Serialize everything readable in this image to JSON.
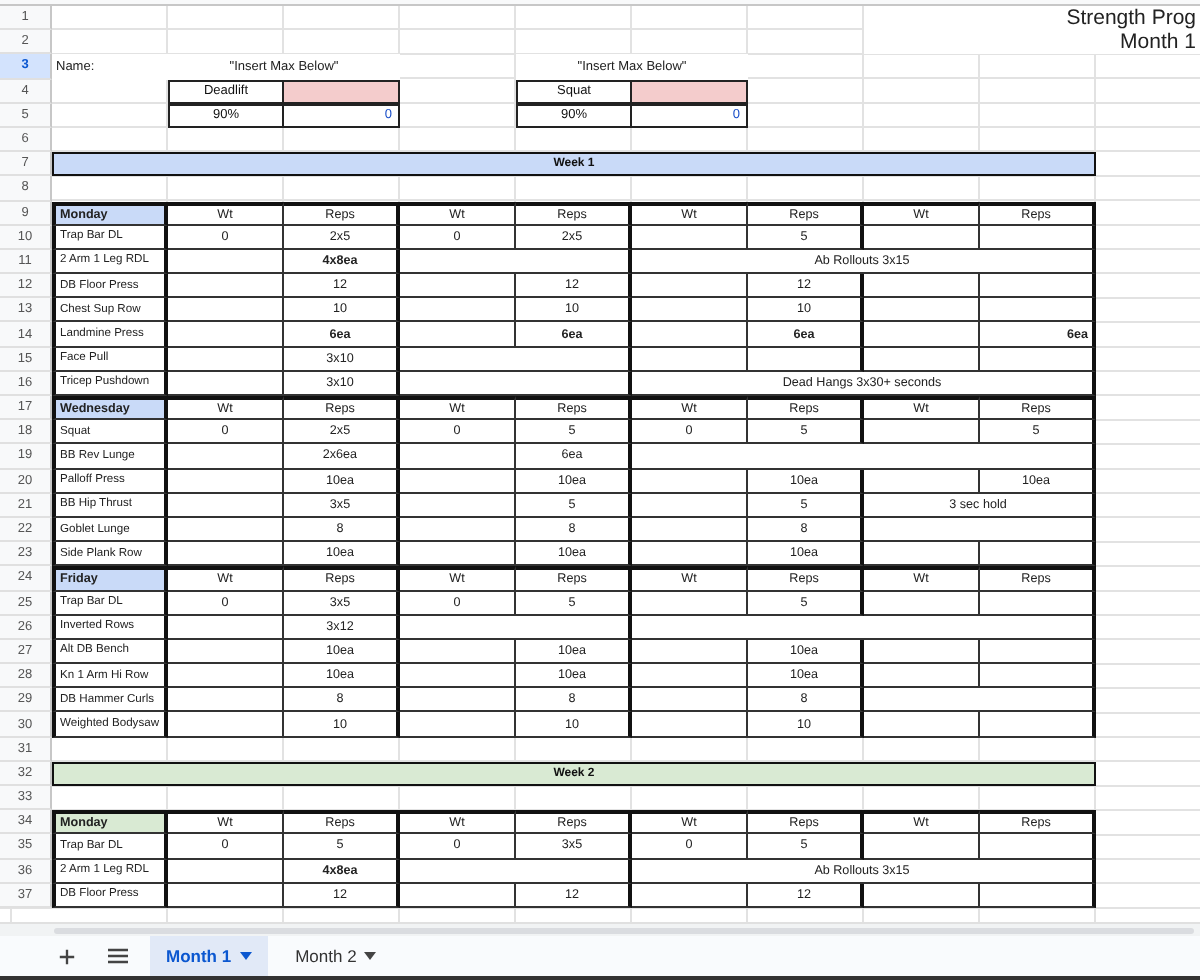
{
  "rows": [
    {
      "number": "1",
      "selected": false,
      "kind": "title",
      "text": "Strength Prog"
    },
    {
      "number": "2",
      "selected": false,
      "kind": "title",
      "text": "Month 1"
    },
    {
      "number": "3",
      "selected": true,
      "kind": "name",
      "label": "Name:",
      "notes": [
        "\"Insert Max Below\"",
        "\"Insert Max Below\""
      ]
    },
    {
      "number": "4",
      "selected": false,
      "kind": "lift_names",
      "lifts": [
        "Deadlift",
        "Squat"
      ]
    },
    {
      "number": "5",
      "selected": false,
      "kind": "lift_values",
      "values": [
        {
          "percent": "90%",
          "result": "0"
        },
        {
          "percent": "90%",
          "result": "0"
        }
      ]
    },
    {
      "number": "6",
      "selected": false,
      "kind": "blank"
    },
    {
      "number": "7",
      "selected": false,
      "kind": "week",
      "label": "Week 1",
      "color": "#c9daf8"
    },
    {
      "number": "8",
      "selected": false,
      "kind": "blank"
    },
    {
      "number": "9",
      "selected": false,
      "kind": "day",
      "label": "Monday",
      "headers": [
        "Wt",
        "Reps",
        "Wt",
        "Reps",
        "Wt",
        "Reps",
        "Wt",
        "Reps"
      ]
    },
    {
      "number": "10",
      "selected": false,
      "kind": "exercise",
      "name": "Trap Bar DL",
      "cells": [
        {
          "text": "0"
        },
        {
          "text": "2x5"
        },
        {
          "text": "0"
        },
        {
          "text": "2x5"
        },
        {},
        {
          "text": "5"
        },
        {},
        {}
      ]
    },
    {
      "number": "11",
      "selected": false,
      "kind": "exercise",
      "name": "2 Arm 1 Leg RDL",
      "cells": [
        {},
        {
          "text": "4x8ea",
          "bold": true
        },
        {},
        {
          "merged": true
        },
        {
          "text": "Ab Rollouts 3x15"
        },
        {
          "merged": true
        },
        {
          "merged": true
        },
        {
          "merged": true
        }
      ]
    },
    {
      "number": "12",
      "selected": false,
      "kind": "exercise",
      "name": "DB Floor Press",
      "cells": [
        {},
        {
          "text": "12"
        },
        {},
        {
          "text": "12"
        },
        {},
        {
          "text": "12"
        },
        {},
        {}
      ]
    },
    {
      "number": "13",
      "selected": false,
      "kind": "exercise",
      "name": "Chest Sup Row",
      "cells": [
        {},
        {
          "text": "10"
        },
        {},
        {
          "text": "10"
        },
        {},
        {
          "text": "10"
        },
        {},
        {}
      ]
    },
    {
      "number": "14",
      "selected": false,
      "kind": "exercise",
      "name": "Landmine Press",
      "cells": [
        {},
        {
          "text": "6ea",
          "bold": true
        },
        {},
        {
          "text": "6ea",
          "bold": true
        },
        {},
        {
          "text": "6ea",
          "bold": true
        },
        {},
        {
          "text": "6ea",
          "bold": true
        }
      ]
    },
    {
      "number": "15",
      "selected": false,
      "kind": "exercise",
      "name": "Face Pull",
      "cells": [
        {},
        {
          "text": "3x10"
        },
        {},
        {
          "merged": true
        },
        {},
        {},
        {},
        {}
      ]
    },
    {
      "number": "16",
      "selected": false,
      "kind": "exercise",
      "name": "Tricep Pushdown",
      "cells": [
        {},
        {
          "text": "3x10"
        },
        {},
        {
          "merged": true
        },
        {
          "text": "Dead Hangs 3x30+ seconds"
        },
        {
          "merged": true
        },
        {
          "merged": true
        },
        {
          "merged": true
        }
      ]
    },
    {
      "number": "17",
      "selected": false,
      "kind": "day",
      "label": "Wednesday",
      "headers": [
        "Wt",
        "Reps",
        "Wt",
        "Reps",
        "Wt",
        "Reps",
        "Wt",
        "Reps"
      ]
    },
    {
      "number": "18",
      "selected": false,
      "kind": "exercise",
      "name": "Squat",
      "cells": [
        {
          "text": "0"
        },
        {
          "text": "2x5"
        },
        {
          "text": "0"
        },
        {
          "text": "5"
        },
        {
          "text": "0"
        },
        {
          "text": "5"
        },
        {},
        {
          "text": "5"
        }
      ]
    },
    {
      "number": "19",
      "selected": false,
      "kind": "exercise",
      "name": "BB Rev Lunge",
      "cells": [
        {},
        {
          "text": "2x6ea"
        },
        {},
        {
          "text": "6ea"
        },
        {},
        {
          "merged": true
        },
        {
          "merged": true
        },
        {
          "merged": true
        }
      ]
    },
    {
      "number": "20",
      "selected": false,
      "kind": "exercise",
      "name": "Palloff Press",
      "cells": [
        {},
        {
          "text": "10ea"
        },
        {},
        {
          "text": "10ea"
        },
        {},
        {
          "text": "10ea"
        },
        {},
        {
          "text": "10ea"
        }
      ]
    },
    {
      "number": "21",
      "selected": false,
      "kind": "exercise",
      "name": "BB Hip Thrust",
      "cells": [
        {},
        {
          "text": "3x5"
        },
        {},
        {
          "text": "5"
        },
        {},
        {
          "text": "5"
        },
        {
          "text": "3 sec hold"
        },
        {
          "merged": true
        }
      ]
    },
    {
      "number": "22",
      "selected": false,
      "kind": "exercise",
      "name": "Goblet Lunge",
      "cells": [
        {},
        {
          "text": "8"
        },
        {},
        {
          "text": "8"
        },
        {},
        {
          "text": "8"
        },
        {},
        {
          "merged": true
        }
      ]
    },
    {
      "number": "23",
      "selected": false,
      "kind": "exercise",
      "name": "Side Plank Row",
      "cells": [
        {},
        {
          "text": "10ea"
        },
        {},
        {
          "text": "10ea"
        },
        {},
        {
          "text": "10ea"
        },
        {},
        {}
      ]
    },
    {
      "number": "24",
      "selected": false,
      "kind": "day",
      "label": "Friday",
      "headers": [
        "Wt",
        "Reps",
        "Wt",
        "Reps",
        "Wt",
        "Reps",
        "Wt",
        "Reps"
      ]
    },
    {
      "number": "25",
      "selected": false,
      "kind": "exercise",
      "name": "Trap Bar DL",
      "cells": [
        {
          "text": "0"
        },
        {
          "text": "3x5"
        },
        {
          "text": "0"
        },
        {
          "text": "5"
        },
        {},
        {
          "text": "5"
        },
        {},
        {}
      ]
    },
    {
      "number": "26",
      "selected": false,
      "kind": "exercise",
      "name": "Inverted Rows",
      "cells": [
        {},
        {
          "text": "3x12"
        },
        {},
        {
          "merged": true
        },
        {},
        {
          "merged": true
        },
        {
          "merged": true
        },
        {
          "merged": true
        }
      ]
    },
    {
      "number": "27",
      "selected": false,
      "kind": "exercise",
      "name": "Alt DB Bench",
      "cells": [
        {},
        {
          "text": "10ea"
        },
        {},
        {
          "text": "10ea"
        },
        {},
        {
          "text": "10ea"
        },
        {},
        {}
      ]
    },
    {
      "number": "28",
      "selected": false,
      "kind": "exercise",
      "name": "Kn 1 Arm Hi Row",
      "cells": [
        {},
        {
          "text": "10ea"
        },
        {},
        {
          "text": "10ea"
        },
        {},
        {
          "text": "10ea"
        },
        {},
        {}
      ]
    },
    {
      "number": "29",
      "selected": false,
      "kind": "exercise",
      "name": "DB Hammer Curls",
      "cells": [
        {},
        {
          "text": "8"
        },
        {},
        {
          "text": "8"
        },
        {},
        {
          "text": "8"
        },
        {},
        {
          "merged": true
        }
      ]
    },
    {
      "number": "30",
      "selected": false,
      "kind": "exercise",
      "name": "Weighted Bodysaw",
      "cells": [
        {},
        {
          "text": "10"
        },
        {},
        {
          "text": "10"
        },
        {},
        {
          "text": "10"
        },
        {},
        {}
      ]
    },
    {
      "number": "31",
      "selected": false,
      "kind": "blank"
    },
    {
      "number": "32",
      "selected": false,
      "kind": "week",
      "label": "Week 2",
      "color": "#d9ead3"
    },
    {
      "number": "33",
      "selected": false,
      "kind": "blank"
    },
    {
      "number": "34",
      "selected": false,
      "kind": "day",
      "label": "Monday",
      "headers": [
        "Wt",
        "Reps",
        "Wt",
        "Reps",
        "Wt",
        "Reps",
        "Wt",
        "Reps"
      ]
    },
    {
      "number": "35",
      "selected": false,
      "kind": "exercise",
      "name": "Trap Bar DL",
      "cells": [
        {
          "text": "0"
        },
        {
          "text": "5"
        },
        {
          "text": "0"
        },
        {
          "text": "3x5"
        },
        {
          "text": "0"
        },
        {
          "text": "5"
        },
        {},
        {}
      ]
    },
    {
      "number": "36",
      "selected": false,
      "kind": "exercise",
      "name": "2 Arm 1 Leg RDL",
      "cells": [
        {},
        {
          "text": "4x8ea",
          "bold": true
        },
        {},
        {
          "merged": true
        },
        {
          "text": "Ab Rollouts 3x15"
        },
        {
          "merged": true
        },
        {
          "merged": true
        },
        {
          "merged": true
        }
      ]
    },
    {
      "number": "37",
      "selected": false,
      "kind": "exercise",
      "name": "DB Floor Press",
      "cells": [
        {},
        {
          "text": "12"
        },
        {},
        {
          "text": "12"
        },
        {},
        {
          "text": "12"
        },
        {},
        {}
      ]
    }
  ],
  "sheet_tabs": [
    {
      "label": "Month 1",
      "selected": true
    },
    {
      "label": "Month 2",
      "selected": false
    }
  ]
}
